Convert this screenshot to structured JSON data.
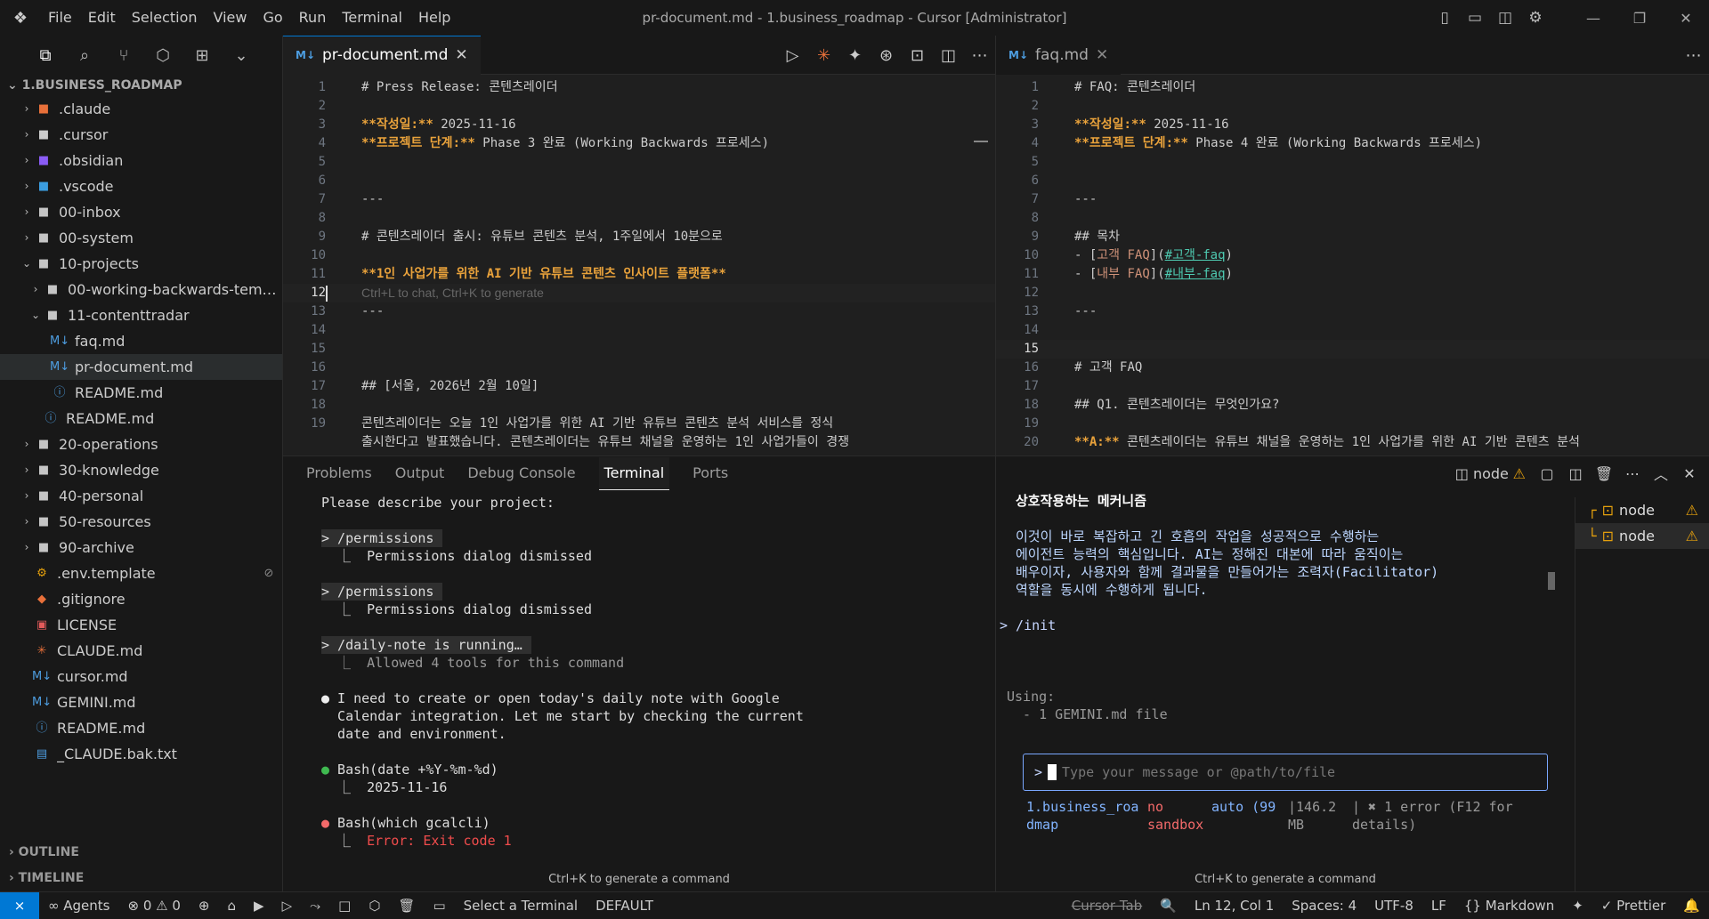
{
  "titlebar": {
    "logo": "❖",
    "menu": [
      "File",
      "Edit",
      "Selection",
      "View",
      "Go",
      "Run",
      "Terminal",
      "Help"
    ],
    "title": "pr-document.md - 1.business_roadmap - Cursor [Administrator]",
    "layout_icons": [
      "▯",
      "▭",
      "◫",
      "⚙"
    ],
    "window": {
      "min": "—",
      "max": "❐",
      "close": "✕"
    }
  },
  "sidebar": {
    "actions": [
      "⧉",
      "⌕",
      "⑂",
      "⬡",
      "⊞",
      "⌄"
    ],
    "root": "1.BUSINESS_ROADMAP",
    "tree": [
      {
        "label": ".claude",
        "chev": "›",
        "icon": "■",
        "color": "#e8703a",
        "indent": 22
      },
      {
        "label": ".cursor",
        "chev": "›",
        "icon": "■",
        "color": "#cccccc",
        "indent": 22
      },
      {
        "label": ".obsidian",
        "chev": "›",
        "icon": "■",
        "color": "#8a5cf5",
        "indent": 22
      },
      {
        "label": ".vscode",
        "chev": "›",
        "icon": "■",
        "color": "#3b9de0",
        "indent": 22
      },
      {
        "label": "00-inbox",
        "chev": "›",
        "icon": "■",
        "color": "#c5c5c5",
        "indent": 22
      },
      {
        "label": "00-system",
        "chev": "›",
        "icon": "■",
        "color": "#c5c5c5",
        "indent": 22
      },
      {
        "label": "10-projects",
        "chev": "⌄",
        "icon": "■",
        "color": "#c5c5c5",
        "indent": 22
      },
      {
        "label": "00-working-backwards-temp...",
        "chev": "›",
        "icon": "■",
        "color": "#c5c5c5",
        "indent": 32
      },
      {
        "label": "11-contenttradar",
        "chev": "⌄",
        "icon": "■",
        "color": "#c5c5c5",
        "indent": 32
      },
      {
        "label": "faq.md",
        "chev": "",
        "icon": "M↓",
        "color": "#4d9de0",
        "indent": 52
      },
      {
        "label": "pr-document.md",
        "chev": "",
        "icon": "M↓",
        "color": "#4d9de0",
        "indent": 52,
        "selected": true
      },
      {
        "label": "README.md",
        "chev": "",
        "icon": "ⓘ",
        "color": "#4d9de0",
        "indent": 52
      },
      {
        "label": "README.md",
        "chev": "",
        "icon": "ⓘ",
        "color": "#4d9de0",
        "indent": 42
      },
      {
        "label": "20-operations",
        "chev": "›",
        "icon": "■",
        "color": "#c5c5c5",
        "indent": 22
      },
      {
        "label": "30-knowledge",
        "chev": "›",
        "icon": "■",
        "color": "#c5c5c5",
        "indent": 22
      },
      {
        "label": "40-personal",
        "chev": "›",
        "icon": "■",
        "color": "#c5c5c5",
        "indent": 22
      },
      {
        "label": "50-resources",
        "chev": "›",
        "icon": "■",
        "color": "#c5c5c5",
        "indent": 22
      },
      {
        "label": "90-archive",
        "chev": "›",
        "icon": "■",
        "color": "#c5c5c5",
        "indent": 22
      },
      {
        "label": ".env.template",
        "chev": "",
        "icon": "⚙",
        "color": "#e5a00d",
        "indent": 32,
        "badge": "⊘"
      },
      {
        "label": ".gitignore",
        "chev": "",
        "icon": "◆",
        "color": "#e8703a",
        "indent": 32
      },
      {
        "label": "LICENSE",
        "chev": "",
        "icon": "▣",
        "color": "#e35a5a",
        "indent": 32
      },
      {
        "label": "CLAUDE.md",
        "chev": "",
        "icon": "✳",
        "color": "#e8703a",
        "indent": 32
      },
      {
        "label": "cursor.md",
        "chev": "",
        "icon": "M↓",
        "color": "#4d9de0",
        "indent": 32
      },
      {
        "label": "GEMINI.md",
        "chev": "",
        "icon": "M↓",
        "color": "#4d9de0",
        "indent": 32
      },
      {
        "label": "README.md",
        "chev": "",
        "icon": "ⓘ",
        "color": "#4d9de0",
        "indent": 32
      },
      {
        "label": "_CLAUDE.bak.txt",
        "chev": "",
        "icon": "▤",
        "color": "#4d9de0",
        "indent": 32
      }
    ],
    "sections": [
      "OUTLINE",
      "TIMELINE"
    ]
  },
  "editor_left": {
    "tab": "pr-document.md",
    "md_badge": "M↓",
    "close": "✕",
    "actions": [
      "▷",
      "✳",
      "✦",
      "⊛",
      "⊡",
      "◫",
      "⋯"
    ],
    "lines": [
      {
        "n": "1",
        "t": "# Press Release: 콘텐츠레이더",
        "k": "plain"
      },
      {
        "n": "2",
        "t": "",
        "k": "plain"
      },
      {
        "n": "3",
        "b": "**작성일:**",
        "t": " 2025-11-16",
        "k": "bold"
      },
      {
        "n": "4",
        "b": "**프로젝트 단계:**",
        "t": " Phase 3 완료 (Working Backwards 프로세스)",
        "k": "bold"
      },
      {
        "n": "5",
        "t": "",
        "k": "plain"
      },
      {
        "n": "6",
        "t": "",
        "k": "plain"
      },
      {
        "n": "7",
        "t": "---",
        "k": "plain"
      },
      {
        "n": "8",
        "t": "",
        "k": "plain"
      },
      {
        "n": "9",
        "t": "# 콘텐츠레이더 출시: 유튜브 콘텐츠 분석, 1주일에서 10분으로",
        "k": "plain"
      },
      {
        "n": "10",
        "t": "",
        "k": "plain"
      },
      {
        "n": "11",
        "b": "**1인 사업가를 위한 AI 기반 유튜브 콘텐츠 인사이트 플랫폼**",
        "t": "",
        "k": "bold"
      },
      {
        "n": "12",
        "t": "Ctrl+L to chat, Ctrl+K to generate",
        "k": "hint",
        "cur": true
      },
      {
        "n": "13",
        "t": "---",
        "k": "plain"
      },
      {
        "n": "14",
        "t": "",
        "k": "plain"
      },
      {
        "n": "15",
        "t": "",
        "k": "plain"
      },
      {
        "n": "16",
        "t": "",
        "k": "plain"
      },
      {
        "n": "17",
        "t": "## [서울, 2026년 2월 10일]",
        "k": "plain"
      },
      {
        "n": "18",
        "t": "",
        "k": "plain"
      },
      {
        "n": "19",
        "t": "콘텐츠레이더는 오늘 1인 사업가를 위한 AI 기반 유튜브 콘텐츠 분석 서비스를 정식",
        "k": "plain"
      },
      {
        "n": "",
        "t": "출시한다고 발표했습니다. 콘텐츠레이더는 유튜브 채널을 운영하는 1인 사업가들이 경쟁",
        "k": "plain"
      }
    ]
  },
  "editor_right": {
    "tab": "faq.md",
    "md_badge": "M↓",
    "close": "✕",
    "more": "⋯",
    "lines": [
      {
        "n": "1",
        "t": "# FAQ: 콘텐츠레이더",
        "k": "plain"
      },
      {
        "n": "2",
        "t": "",
        "k": "plain"
      },
      {
        "n": "3",
        "b": "**작성일:**",
        "t": " 2025-11-16",
        "k": "bold"
      },
      {
        "n": "4",
        "b": "**프로젝트 단계:**",
        "t": " Phase 4 완료 (Working Backwards 프로세스)",
        "k": "bold"
      },
      {
        "n": "5",
        "t": "",
        "k": "plain"
      },
      {
        "n": "6",
        "t": "",
        "k": "plain"
      },
      {
        "n": "7",
        "t": "---",
        "k": "plain"
      },
      {
        "n": "8",
        "t": "",
        "k": "plain"
      },
      {
        "n": "9",
        "t": "## 목차",
        "k": "plain"
      },
      {
        "n": "10",
        "t": "- [",
        "l1": "고객 FAQ",
        "m": "](",
        "l2": "#고객-faq",
        "e": ")",
        "k": "link"
      },
      {
        "n": "11",
        "t": "- [",
        "l1": "내부 FAQ",
        "m": "](",
        "l2": "#내부-faq",
        "e": ")",
        "k": "link"
      },
      {
        "n": "12",
        "t": "",
        "k": "plain"
      },
      {
        "n": "13",
        "t": "---",
        "k": "plain"
      },
      {
        "n": "14",
        "t": "",
        "k": "plain"
      },
      {
        "n": "15",
        "t": "",
        "k": "plain",
        "cur": true
      },
      {
        "n": "16",
        "t": "# 고객 FAQ",
        "k": "plain"
      },
      {
        "n": "17",
        "t": "",
        "k": "plain"
      },
      {
        "n": "18",
        "t": "## Q1. 콘텐츠레이더는 무엇인가요?",
        "k": "plain"
      },
      {
        "n": "19",
        "t": "",
        "k": "plain"
      },
      {
        "n": "20",
        "b": "**A:**",
        "t": " 콘텐츠레이더는 유튜브 채널을 운영하는 1인 사업가를 위한 AI 기반 콘텐츠 분석",
        "k": "bold"
      }
    ]
  },
  "panel_left": {
    "tabs": [
      "Problems",
      "Output",
      "Debug Console",
      "Terminal",
      "Ports"
    ],
    "active_tab": "Terminal",
    "terminal": [
      {
        "t": "Please describe your project:",
        "k": "plain"
      },
      {
        "t": "",
        "k": "plain"
      },
      {
        "t": "> /permissions",
        "k": "cmd"
      },
      {
        "t": "  ⎿  Permissions dialog dismissed",
        "k": "plain"
      },
      {
        "t": "",
        "k": "plain"
      },
      {
        "t": "> /permissions",
        "k": "cmd"
      },
      {
        "t": "  ⎿  Permissions dialog dismissed",
        "k": "plain"
      },
      {
        "t": "",
        "k": "plain"
      },
      {
        "t": "> /daily-note is running…",
        "k": "cmd"
      },
      {
        "t": "  ⎿  Allowed 4 tools for this command",
        "k": "dim"
      },
      {
        "t": "",
        "k": "plain"
      },
      {
        "b": "●",
        "t": " I need to create or open today's daily note with Google",
        "k": "bw"
      },
      {
        "t": "  Calendar integration. Let me start by checking the current",
        "k": "plain"
      },
      {
        "t": "  date and environment.",
        "k": "plain"
      },
      {
        "t": "",
        "k": "plain"
      },
      {
        "b": "●",
        "t": " Bash(date +%Y-%m-%d)",
        "k": "bg"
      },
      {
        "t": "  ⎿  2025-11-16",
        "k": "plain"
      },
      {
        "t": "",
        "k": "plain"
      },
      {
        "b": "●",
        "t": " Bash(which gcalcli)",
        "k": "br"
      },
      {
        "t": "  ⎿  ",
        "e": "Error: Exit code 1",
        "k": "err"
      }
    ],
    "footer": "Ctrl+K to generate a command"
  },
  "panel_right": {
    "tools": {
      "node": "node",
      "warn": "⚠",
      "split": "◫",
      "layout": "▢",
      "trash": "🗑",
      "more": "⋯",
      "up": "︿",
      "close": "✕"
    },
    "gemini": [
      {
        "t": "상호작용하는 메커니즘",
        "k": "h"
      },
      {
        "t": "",
        "k": "plain"
      },
      {
        "t": "이것이 바로 복잡하고 긴 호흡의 작업을 성공적으로 수행하는",
        "k": "plain"
      },
      {
        "t": "에이전트 능력의 핵심입니다. AI는 정해진 대본에 따라 움직이는",
        "k": "plain"
      },
      {
        "t": "배우이자, 사용자와 함께 결과물을 만들어가는 조력자(Facilitator)",
        "k": "plain"
      },
      {
        "t": "역할을 동시에 수행하게 됩니다.",
        "k": "plain"
      },
      {
        "t": "",
        "k": "plain"
      },
      {
        "t": "> /init",
        "k": "prompt"
      },
      {
        "t": "",
        "k": "plain"
      },
      {
        "t": "",
        "k": "plain"
      },
      {
        "t": "",
        "k": "plain"
      },
      {
        "t": "Using:",
        "k": "using"
      },
      {
        "t": "  - 1 GEMINI.md file",
        "k": "using"
      }
    ],
    "input": {
      "gt": ">",
      "placeholder": "Type your message or @path/to/file"
    },
    "status": {
      "dir": "1.business_roa\ndmap",
      "sandbox": "no\nsandbox",
      "model": "auto (99",
      "mem": "|146.2\nMB",
      "error": "| ✖ 1 error (F12 for\ndetails)"
    },
    "processes": [
      {
        "label": "node",
        "prefix": "┌",
        "warn": "⚠"
      },
      {
        "label": "node",
        "prefix": "└",
        "warn": "⚠",
        "selected": true
      }
    ],
    "footer": "Ctrl+K to generate a command"
  },
  "statusbar": {
    "remote": "⨯",
    "left": [
      "∞ Agents",
      "⊗ 0 ⚠ 0",
      "⊕",
      "⌂",
      "▶",
      "▷",
      "⤳",
      "□",
      "⬡",
      "🗑",
      "▭",
      "Select a Terminal",
      "DEFAULT"
    ],
    "cursor_tab": "Cursor Tab",
    "right": [
      "🔍",
      "Ln 12, Col 1",
      "Spaces: 4",
      "UTF-8",
      "LF",
      "{} Markdown",
      "✦",
      "✓ Prettier",
      "🔔"
    ]
  }
}
